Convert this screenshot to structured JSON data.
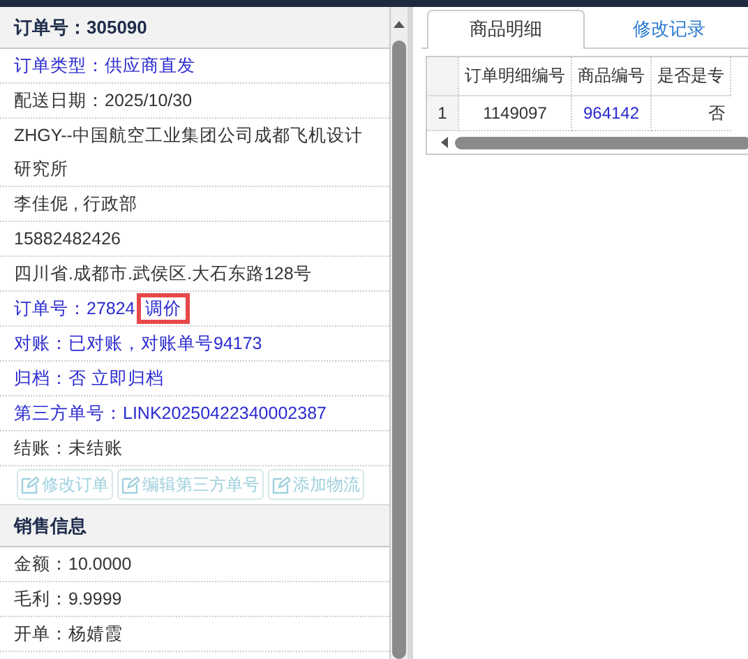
{
  "order_panel": {
    "title": "订单号：305090",
    "rows": [
      {
        "parts": [
          {
            "text": "订单类型：供应商直发",
            "kind": "link"
          }
        ]
      },
      {
        "parts": [
          {
            "text": "配送日期：2025/10/30",
            "kind": "plain"
          }
        ]
      },
      {
        "parts": [
          {
            "text": "ZHGY--中国航空工业集团公司成都飞机设计研究所",
            "kind": "plain"
          }
        ]
      },
      {
        "parts": [
          {
            "text": "李佳伲 , 行政部",
            "kind": "plain"
          }
        ]
      },
      {
        "parts": [
          {
            "text": "15882482426",
            "kind": "plain"
          }
        ]
      },
      {
        "parts": [
          {
            "text": "四川省.成都市.武侯区.大石东路128号",
            "kind": "plain"
          }
        ]
      },
      {
        "parts": [
          {
            "text": "订单号：27824",
            "kind": "link"
          },
          {
            "text": "调价",
            "kind": "link",
            "highlighted": true
          }
        ]
      },
      {
        "parts": [
          {
            "text": "对账：已对账，对账单号94173",
            "kind": "link"
          }
        ]
      },
      {
        "parts": [
          {
            "text": "归档：",
            "kind": "link"
          },
          {
            "text": "否 立即归档",
            "kind": "link"
          }
        ]
      },
      {
        "parts": [
          {
            "text": "第三方单号：LINK20250422340002387",
            "kind": "link"
          }
        ]
      },
      {
        "parts": [
          {
            "text": "结账：未结账",
            "kind": "plain"
          }
        ]
      }
    ],
    "buttons": [
      {
        "label": "修改订单",
        "disabled": true
      },
      {
        "label": "编辑第三方单号",
        "disabled": true
      },
      {
        "label": "添加物流",
        "disabled": true
      }
    ]
  },
  "sales_panel": {
    "title": "销售信息",
    "rows": [
      "金额：10.0000",
      "毛利：9.9999",
      "开单：杨婧霞"
    ]
  },
  "tabs": [
    {
      "label": "商品明细",
      "selected": true
    },
    {
      "label": "修改记录",
      "selected": false
    }
  ],
  "grid": {
    "columns": [
      "订单明细编号",
      "商品编号",
      "是否是专"
    ],
    "rows": [
      {
        "index": "1",
        "cells": [
          {
            "text": "1149097",
            "kind": "plain"
          },
          {
            "text": "964142",
            "kind": "link"
          },
          {
            "text": "否",
            "kind": "plain"
          }
        ]
      }
    ]
  }
}
